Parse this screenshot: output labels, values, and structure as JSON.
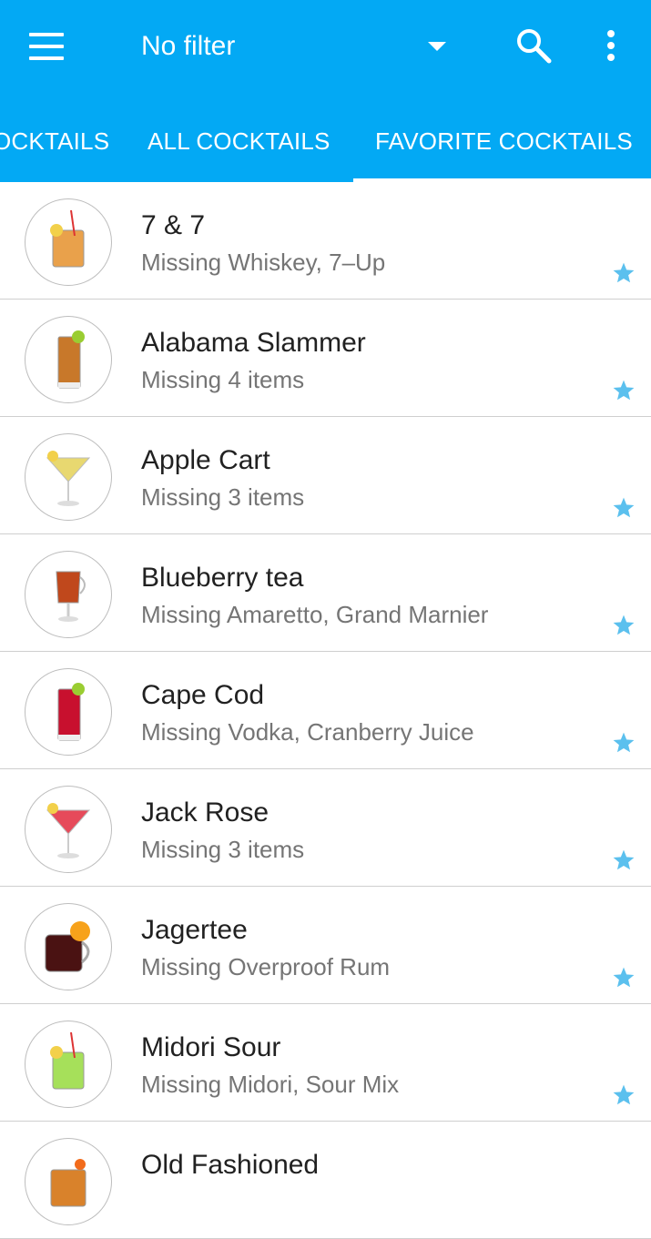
{
  "toolbar": {
    "menu_icon": "hamburger-menu-icon",
    "filter_title": "No filter",
    "dropdown_icon": "dropdown-arrow-icon",
    "search_icon": "search-icon",
    "more_icon": "more-vert-icon",
    "background_color": "#03A9F4"
  },
  "tabs": [
    {
      "label": "OCKTAILS",
      "selected": false
    },
    {
      "label": "ALL COCKTAILS",
      "selected": false
    },
    {
      "label": "FAVORITE COCKTAILS",
      "selected": true
    }
  ],
  "cocktails": [
    {
      "name": "7 & 7",
      "missing": "Missing Whiskey, 7–Up",
      "favorite": true,
      "drink_color": "#E9A14B",
      "image_icon": "highball-drink-icon"
    },
    {
      "name": "Alabama Slammer",
      "missing": "Missing 4 items",
      "favorite": true,
      "drink_color": "#C8782A",
      "image_icon": "tall-glass-drink-icon"
    },
    {
      "name": "Apple Cart",
      "missing": "Missing 3 items",
      "favorite": true,
      "drink_color": "#E8D870",
      "image_icon": "martini-glass-icon"
    },
    {
      "name": "Blueberry tea",
      "missing": "Missing Amaretto, Grand Marnier",
      "favorite": true,
      "drink_color": "#C0481C",
      "image_icon": "toddy-glass-icon"
    },
    {
      "name": "Cape Cod",
      "missing": "Missing Vodka, Cranberry Juice",
      "favorite": true,
      "drink_color": "#C8102E",
      "image_icon": "tall-glass-drink-icon"
    },
    {
      "name": "Jack Rose",
      "missing": "Missing 3 items",
      "favorite": true,
      "drink_color": "#E64A5A",
      "image_icon": "martini-glass-icon"
    },
    {
      "name": "Jagertee",
      "missing": "Missing Overproof Rum",
      "favorite": true,
      "drink_color": "#4A1212",
      "image_icon": "mug-drink-icon"
    },
    {
      "name": "Midori Sour",
      "missing": "Missing Midori, Sour Mix",
      "favorite": true,
      "drink_color": "#A6E05A",
      "image_icon": "highball-drink-icon"
    },
    {
      "name": "Old Fashioned",
      "missing": "",
      "favorite": true,
      "drink_color": "#D9822B",
      "image_icon": "lowball-drink-icon"
    }
  ],
  "star_color": "#5BC0EE",
  "divider_color": "#CFCFCF"
}
